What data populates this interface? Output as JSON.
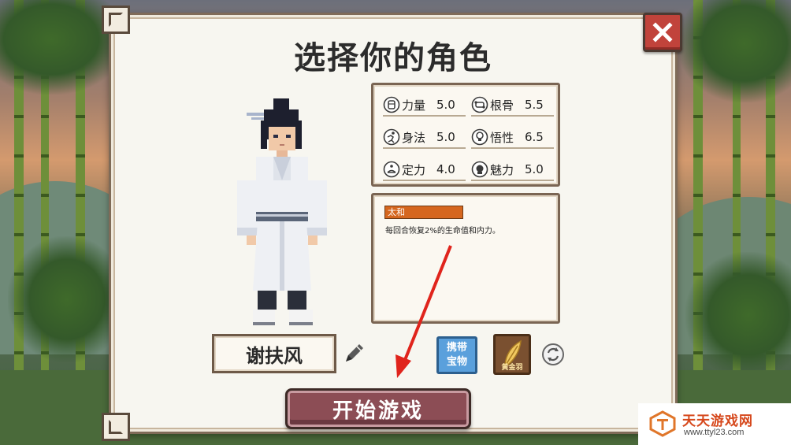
{
  "title": "选择你的角色",
  "stats": [
    {
      "icon": "fist-icon",
      "name": "力量",
      "value": "5.0"
    },
    {
      "icon": "bone-icon",
      "name": "根骨",
      "value": "5.5"
    },
    {
      "icon": "running-figure-icon",
      "name": "身法",
      "value": "5.0"
    },
    {
      "icon": "lightbulb-icon",
      "name": "悟性",
      "value": "6.5"
    },
    {
      "icon": "meditation-icon",
      "name": "定力",
      "value": "4.0"
    },
    {
      "icon": "charm-face-icon",
      "name": "魅力",
      "value": "5.0"
    }
  ],
  "talent": {
    "name": "太和",
    "description": "每回合恢复2%的生命值和内力。",
    "tag_color": "#d5661e"
  },
  "character": {
    "name": "谢扶风"
  },
  "treasure": {
    "carry_label": "携带宝物",
    "item_label": "黄金羽"
  },
  "start_label": "开始游戏",
  "watermark": {
    "name": "天天游戏网",
    "url": "www.ttyl23.com"
  },
  "colors": {
    "close_button": "#c1433b",
    "start_button": "#8c4d55",
    "carry_button": "#5aa0dc",
    "annotation_arrow": "#e0241c"
  }
}
